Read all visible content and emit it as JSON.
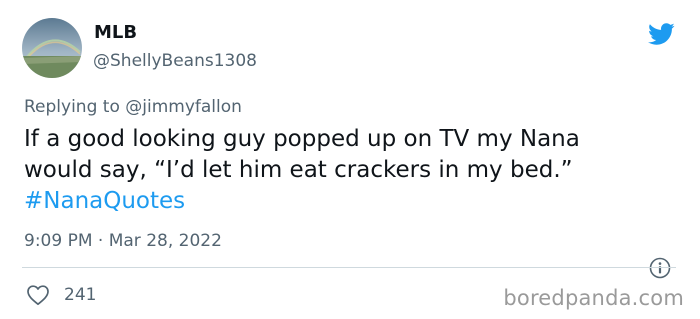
{
  "author": {
    "name": "MLB",
    "handle": "@ShellyBeans1308"
  },
  "reply": {
    "prefix": "Replying to",
    "mention": "@jimmyfallon"
  },
  "tweet": {
    "line1": "If a good looking guy popped up on TV my Nana",
    "line2": "would say, “I’d let him eat crackers in my bed.”",
    "hashtag": "#NanaQuotes"
  },
  "meta": {
    "time": "9:09 PM",
    "separator": "·",
    "date": "Mar 28, 2022"
  },
  "stats": {
    "likes": "241"
  },
  "icons": {
    "brand": "twitter-bird-icon",
    "info": "info-icon",
    "like": "heart-icon"
  },
  "colors": {
    "accent": "#1d9bf0",
    "text": "#0f1419",
    "muted": "#536471"
  },
  "watermark": "boredpanda.com"
}
